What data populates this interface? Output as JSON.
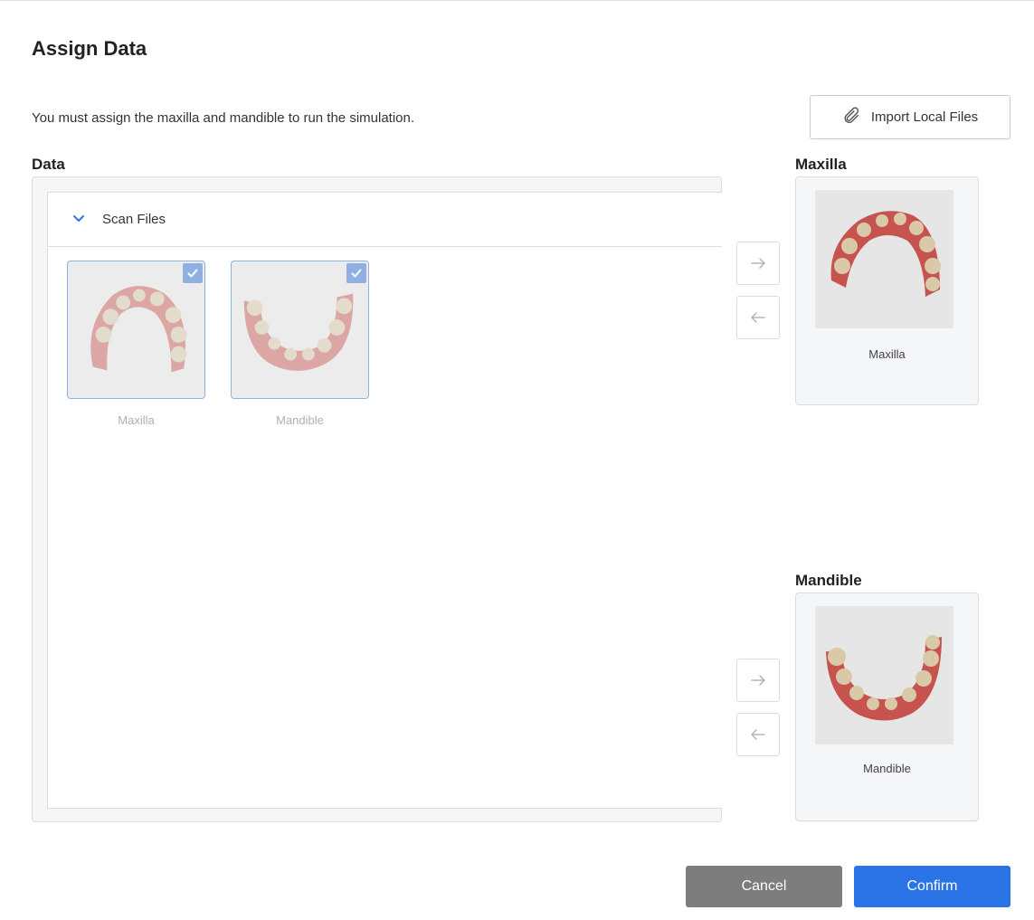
{
  "dialog": {
    "title": "Assign Data",
    "subtitle": "You must assign the maxilla and mandible to run the simulation.",
    "import_button": "Import Local Files"
  },
  "data_section": {
    "label": "Data",
    "group_label": "Scan Files",
    "files": [
      {
        "label": "Maxilla",
        "checked": true,
        "icon": "maxilla-scan"
      },
      {
        "label": "Mandible",
        "checked": true,
        "icon": "mandible-scan"
      }
    ]
  },
  "maxilla_section": {
    "label": "Maxilla",
    "assigned_label": "Maxilla"
  },
  "mandible_section": {
    "label": "Mandible",
    "assigned_label": "Mandible"
  },
  "footer": {
    "cancel_label": "Cancel",
    "confirm_label": "Confirm"
  },
  "colors": {
    "accent": "#2b74e8",
    "cancel": "#7d7d7d",
    "selection": "#8fb0e0",
    "gum": "#c7534f",
    "tooth": "#d9c9a8"
  }
}
